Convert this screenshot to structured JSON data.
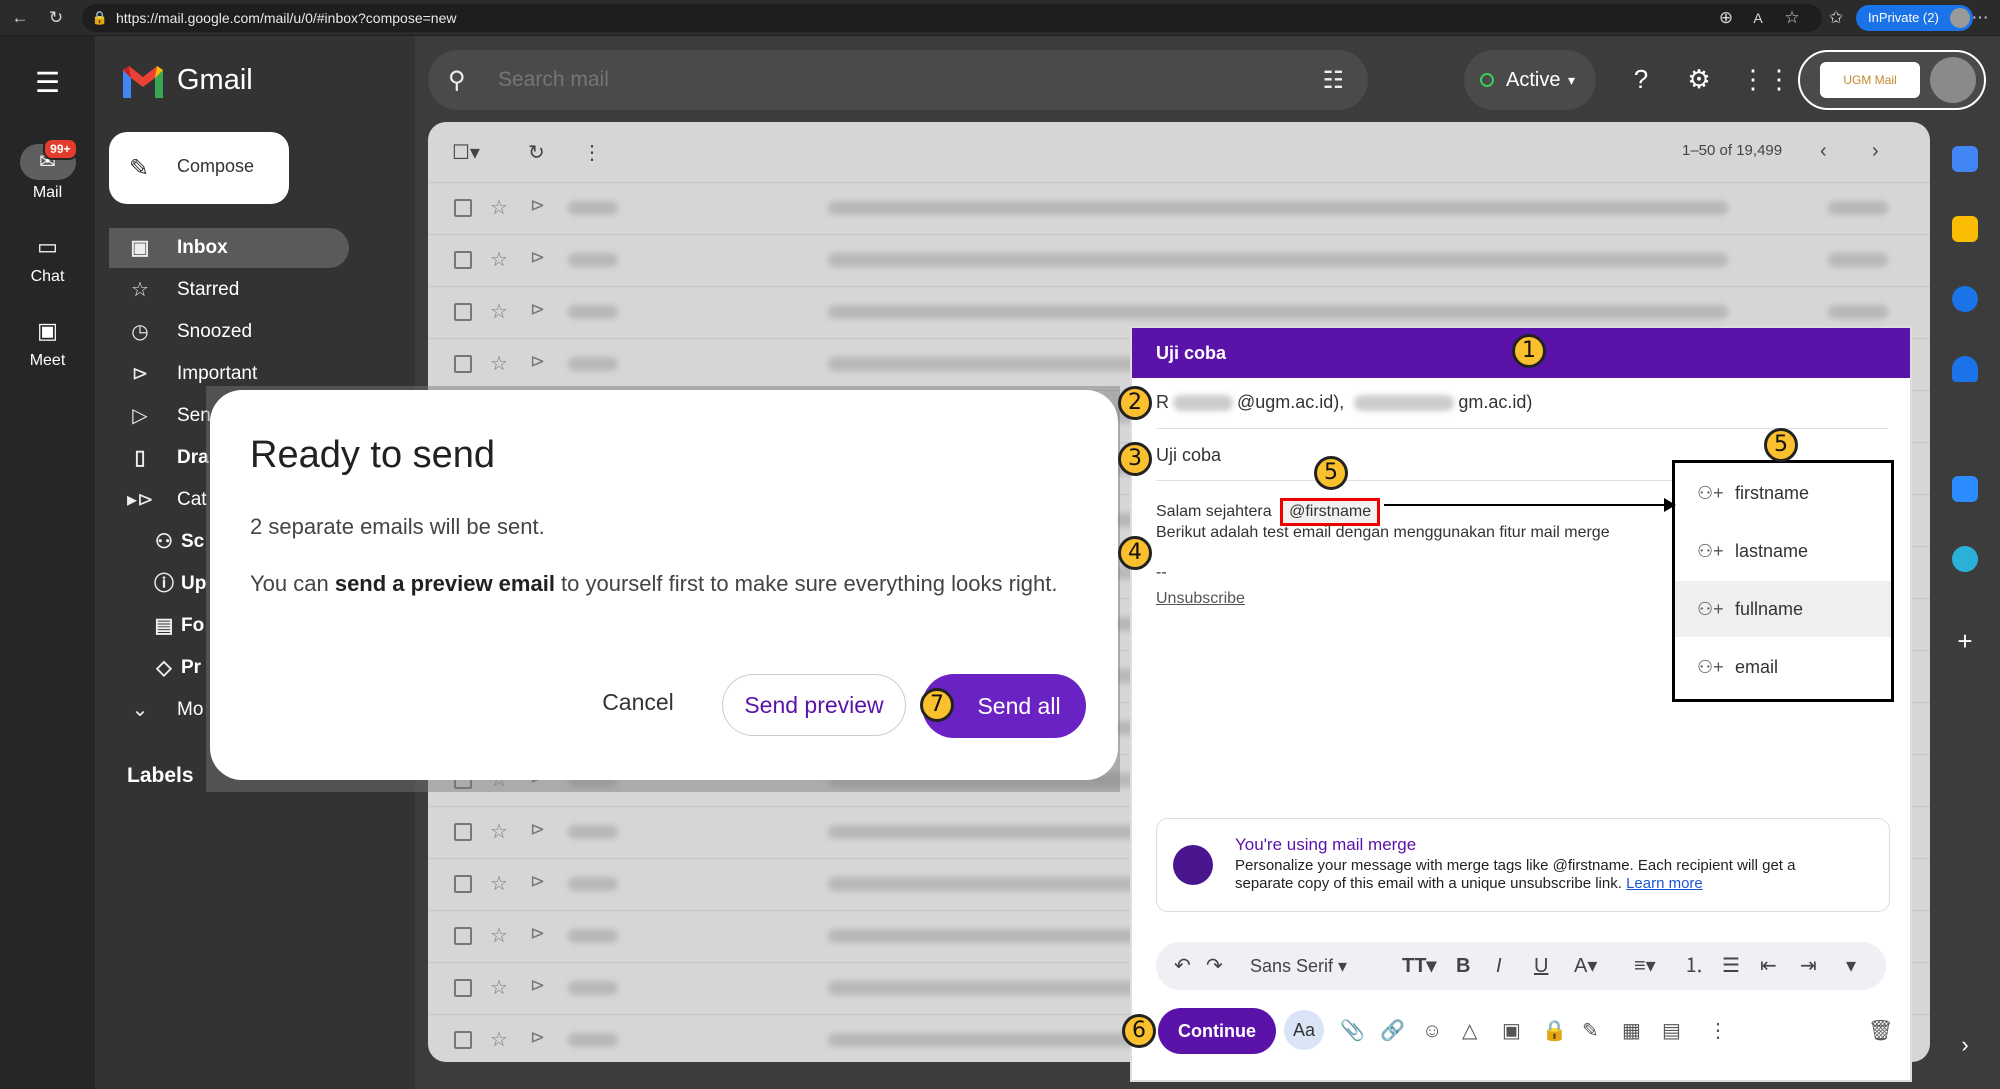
{
  "browser": {
    "url": "https://mail.google.com/mail/u/0/#inbox?compose=new",
    "profile": "InPrivate (2)"
  },
  "rail": [
    {
      "label": "Mail",
      "icon": "mail-icon",
      "badge": "99+"
    },
    {
      "label": "Chat",
      "icon": "chat-icon"
    },
    {
      "label": "Meet",
      "icon": "meet-icon"
    }
  ],
  "app": {
    "name": "Gmail"
  },
  "compose_button": "Compose",
  "nav": [
    {
      "label": "Inbox",
      "icon": "inbox-icon"
    },
    {
      "label": "Starred",
      "icon": "star-icon"
    },
    {
      "label": "Snoozed",
      "icon": "clock-icon"
    },
    {
      "label": "Important",
      "icon": "important-icon"
    },
    {
      "label": "Sen",
      "icon": "send-icon"
    },
    {
      "label": "Dra",
      "icon": "draft-icon"
    },
    {
      "label": "Cat",
      "icon": "label-icon"
    },
    {
      "label": "Sc",
      "icon": "people-icon"
    },
    {
      "label": "Up",
      "icon": "info-icon"
    },
    {
      "label": "Fo",
      "icon": "forum-icon"
    },
    {
      "label": "Pr",
      "icon": "tag-icon"
    },
    {
      "label": "Mo",
      "icon": "chevron-down-icon"
    }
  ],
  "labels_heading": "Labels",
  "search": {
    "placeholder": "Search mail"
  },
  "status": {
    "label": "Active",
    "color": "#34d058"
  },
  "account": {
    "org_logo": "UGM Mail"
  },
  "pager": "1–50 of 19,499",
  "compose": {
    "title": "Uji coba",
    "to_prefix": "R",
    "to_domain1": "@ugm.ac.id),",
    "to_domain2": "gm.ac.id)",
    "subject": "Uji coba",
    "greeting": "Salam sejahtera",
    "merge_tag": "@firstname",
    "line2": "Berikut adalah test email dengan menggunakan fitur mail merge",
    "signature": "--",
    "unsubscribe": "Unsubscribe",
    "merge_options": [
      "firstname",
      "lastname",
      "fullname",
      "email"
    ],
    "info_title": "You're using mail merge",
    "info_text": "Personalize your message with merge tags like @firstname. Each recipient will get a separate copy of this email with a unique unsubscribe link.",
    "info_link": "Learn more",
    "font": "Sans Serif",
    "continue": "Continue",
    "aa": "Aa"
  },
  "dialog": {
    "title": "Ready to send",
    "line1": "2 separate emails will be sent.",
    "line2_pre": "You can ",
    "line2_bold": "send a preview email",
    "line2_post": " to yourself first to make sure everything looks right.",
    "cancel": "Cancel",
    "preview": "Send preview",
    "send_all": "Send all"
  },
  "steps": [
    "1",
    "2",
    "3",
    "4",
    "5",
    "5",
    "6",
    "7"
  ]
}
